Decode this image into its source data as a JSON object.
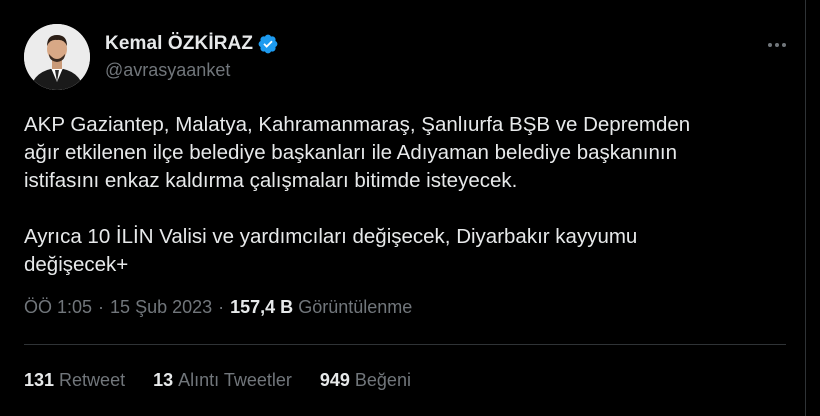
{
  "author": {
    "display_name": "Kemal ÖZKİRAZ",
    "handle": "@avrasyaanket",
    "verified": true,
    "verified_color": "#1d9bf0"
  },
  "tweet": {
    "text": "AKP Gaziantep, Malatya, Kahramanmaraş, Şanlıurfa BŞB ve Depremden\nağır etkilenen ilçe belediye başkanları ile Adıyaman belediye başkanının\nistifasını enkaz kaldırma çalışmaları bitimde isteyecek.\n\nAyrıca 10 İLİN Valisi ve yardımcıları değişecek, Diyarbakır kayyumu\ndeğişecek+"
  },
  "meta": {
    "time": "ÖÖ 1:05",
    "separator": "·",
    "date": "15 Şub 2023",
    "views_count": "157,4 B",
    "views_label": "Görüntülenme"
  },
  "stats": [
    {
      "count": "131",
      "label": "Retweet"
    },
    {
      "count": "13",
      "label": "Alıntı Tweetler"
    },
    {
      "count": "949",
      "label": "Beğeni"
    }
  ],
  "colors": {
    "background": "#000000",
    "text": "#e7e9ea",
    "muted": "#71767b",
    "divider": "#2f3336"
  },
  "icons": {
    "verified": "verified-badge-icon",
    "more": "more-options-icon"
  }
}
